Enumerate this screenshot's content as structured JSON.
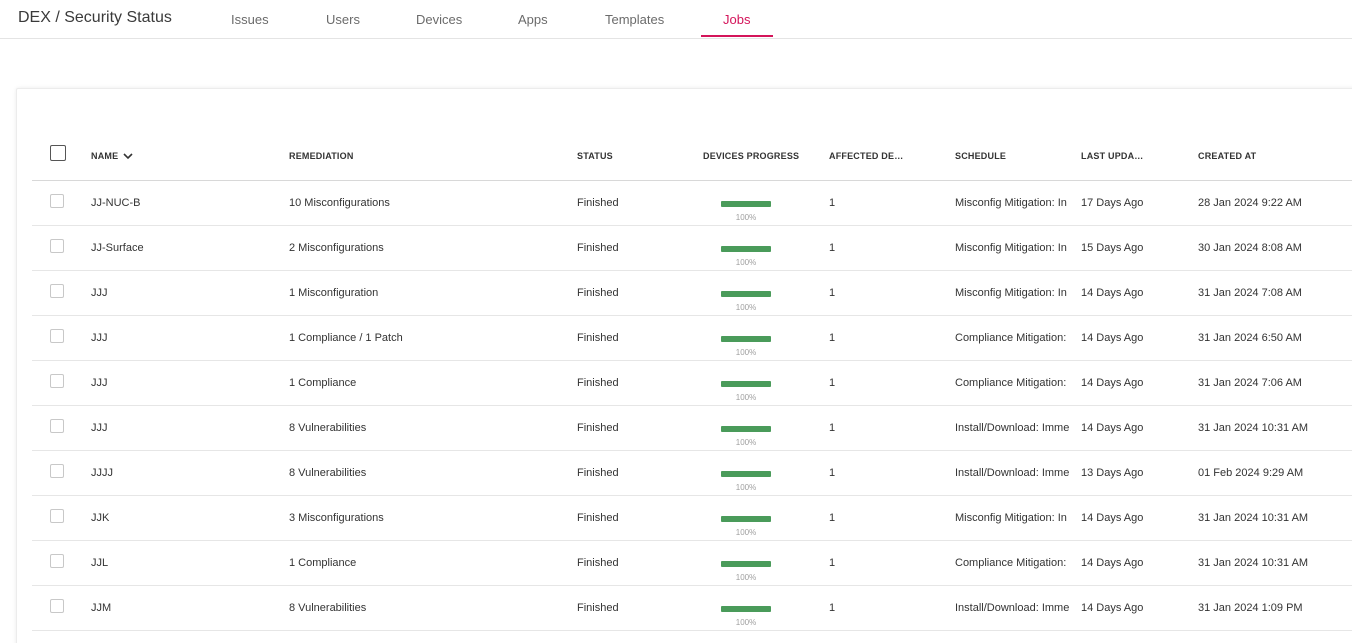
{
  "app_title": "DEX / Security Status",
  "tabs": [
    {
      "label": "Issues"
    },
    {
      "label": "Users"
    },
    {
      "label": "Devices"
    },
    {
      "label": "Apps"
    },
    {
      "label": "Templates"
    },
    {
      "label": "Jobs"
    }
  ],
  "active_tab": "Jobs",
  "accent_color": "#d4145a",
  "progress_color": "#4a9b5a",
  "table": {
    "headers": {
      "name": "NAME",
      "remediation": "REMEDIATION",
      "status": "STATUS",
      "devices_progress": "DEVICES PROGRESS",
      "affected": "AFFECTED DE…",
      "schedule": "SCHEDULE",
      "last_updated": "LAST UPDA…",
      "created_at": "CREATED AT"
    },
    "sort_icon": "chevron-down-icon",
    "rows": [
      {
        "name": "JJ-NUC-B",
        "remediation": "10 Misconfigurations",
        "status": "Finished",
        "progress": 100,
        "progress_label": "100%",
        "affected": "1",
        "schedule": "Misconfig Mitigation: In",
        "last_updated": "17 Days Ago",
        "created_at": "28 Jan 2024 9:22 AM"
      },
      {
        "name": "JJ-Surface",
        "remediation": "2 Misconfigurations",
        "status": "Finished",
        "progress": 100,
        "progress_label": "100%",
        "affected": "1",
        "schedule": "Misconfig Mitigation: In",
        "last_updated": "15 Days Ago",
        "created_at": "30 Jan 2024 8:08 AM"
      },
      {
        "name": "JJJ",
        "remediation": "1 Misconfiguration",
        "status": "Finished",
        "progress": 100,
        "progress_label": "100%",
        "affected": "1",
        "schedule": "Misconfig Mitigation: In",
        "last_updated": "14 Days Ago",
        "created_at": "31 Jan 2024 7:08 AM"
      },
      {
        "name": "JJJ",
        "remediation": "1 Compliance / 1 Patch",
        "status": "Finished",
        "progress": 100,
        "progress_label": "100%",
        "affected": "1",
        "schedule": "Compliance Mitigation:",
        "last_updated": "14 Days Ago",
        "created_at": "31 Jan 2024 6:50 AM"
      },
      {
        "name": "JJJ",
        "remediation": "1 Compliance",
        "status": "Finished",
        "progress": 100,
        "progress_label": "100%",
        "affected": "1",
        "schedule": "Compliance Mitigation:",
        "last_updated": "14 Days Ago",
        "created_at": "31 Jan 2024 7:06 AM"
      },
      {
        "name": "JJJ",
        "remediation": "8 Vulnerabilities",
        "status": "Finished",
        "progress": 100,
        "progress_label": "100%",
        "affected": "1",
        "schedule": "Install/Download: Imme",
        "last_updated": "14 Days Ago",
        "created_at": "31 Jan 2024 10:31 AM"
      },
      {
        "name": "JJJJ",
        "remediation": "8 Vulnerabilities",
        "status": "Finished",
        "progress": 100,
        "progress_label": "100%",
        "affected": "1",
        "schedule": "Install/Download: Imme",
        "last_updated": "13 Days Ago",
        "created_at": "01 Feb 2024 9:29 AM"
      },
      {
        "name": "JJK",
        "remediation": "3 Misconfigurations",
        "status": "Finished",
        "progress": 100,
        "progress_label": "100%",
        "affected": "1",
        "schedule": "Misconfig Mitigation: In",
        "last_updated": "14 Days Ago",
        "created_at": "31 Jan 2024 10:31 AM"
      },
      {
        "name": "JJL",
        "remediation": "1 Compliance",
        "status": "Finished",
        "progress": 100,
        "progress_label": "100%",
        "affected": "1",
        "schedule": "Compliance Mitigation:",
        "last_updated": "14 Days Ago",
        "created_at": "31 Jan 2024 10:31 AM"
      },
      {
        "name": "JJM",
        "remediation": "8 Vulnerabilities",
        "status": "Finished",
        "progress": 100,
        "progress_label": "100%",
        "affected": "1",
        "schedule": "Install/Download: Imme",
        "last_updated": "14 Days Ago",
        "created_at": "31 Jan 2024 1:09 PM"
      }
    ]
  }
}
